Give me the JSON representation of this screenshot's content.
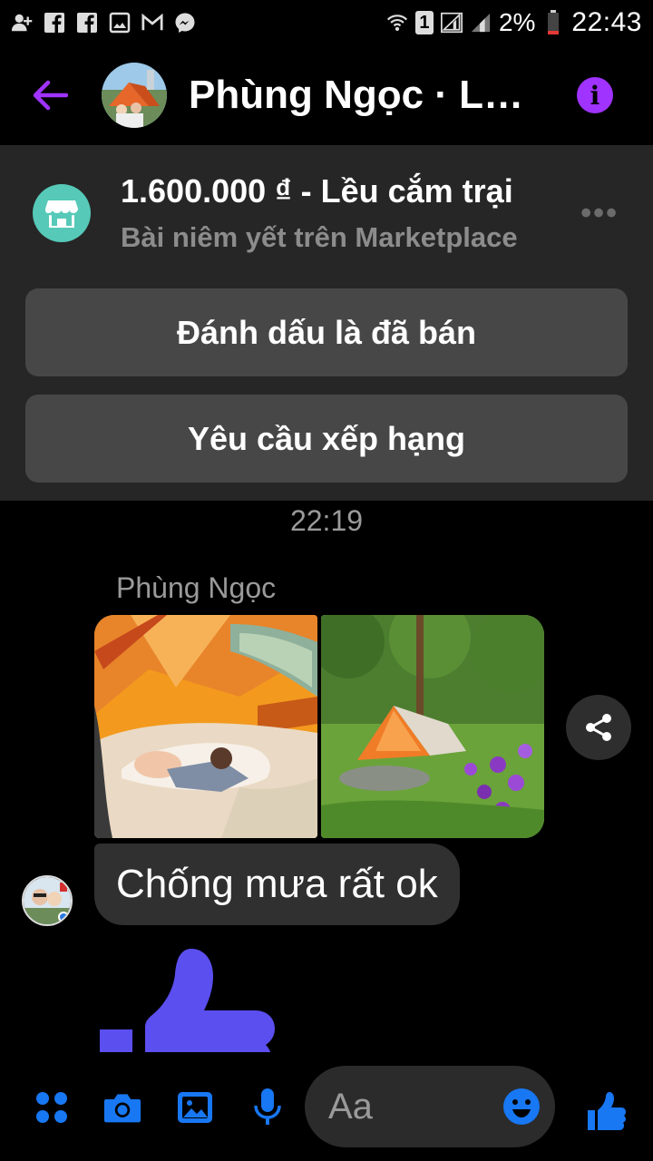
{
  "status_bar": {
    "icons": [
      "add-contact-icon",
      "facebook-icon",
      "facebook-icon",
      "gallery-icon",
      "gmail-icon",
      "messenger-icon"
    ],
    "wifi": "wifi-icon",
    "sim": "1",
    "battery": "2%",
    "time": "22:43"
  },
  "header": {
    "contact_name": "Phùng Ngọc · Lều cắm trại",
    "back_icon": "arrow-left-icon",
    "info_icon": "info-icon",
    "accent_color": "#a033ff"
  },
  "marketplace": {
    "price_title": "1.600.000 ₫ - Lều cắm trại",
    "subtitle": "Bài niêm yết trên Marketplace",
    "more": "•••",
    "mark_sold_label": "Đánh dấu là đã bán",
    "request_rating_label": "Yêu cầu xếp hạng",
    "icon": "shop-icon",
    "icon_color": "#56c9b8"
  },
  "conversation": {
    "timestamp": "22:19",
    "sender_name": "Phùng Ngọc",
    "photos": [
      "tent-interior-photo",
      "tent-garden-photo"
    ],
    "message": "Chống mưa rất ok",
    "reaction": "thumbs-up-icon"
  },
  "composer": {
    "placeholder": "Aa",
    "accent_color": "#1877f2",
    "buttons": [
      "apps-icon",
      "camera-icon",
      "gallery-icon",
      "mic-icon",
      "emoji-icon",
      "thumbs-up-icon"
    ]
  }
}
